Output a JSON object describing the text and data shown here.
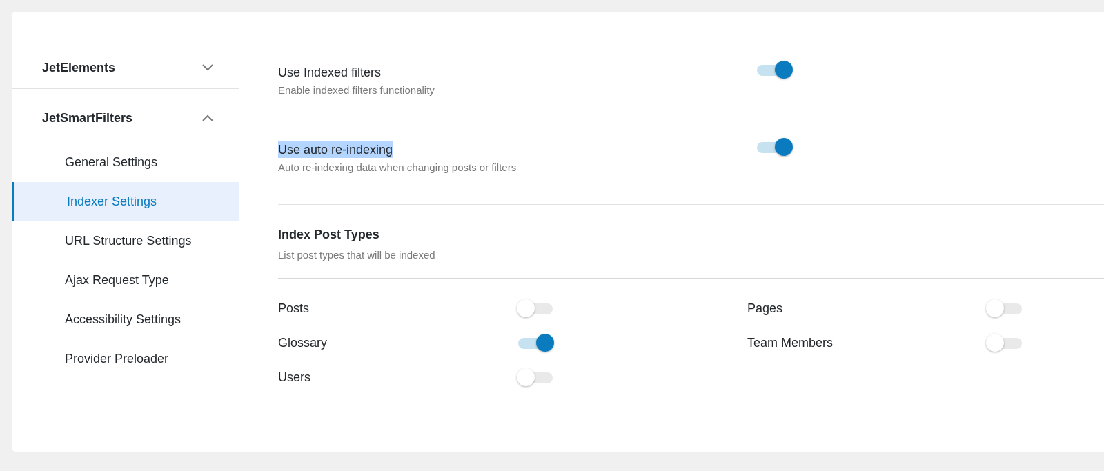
{
  "sidebar": {
    "groups": [
      {
        "label": "JetElements",
        "expanded": false
      },
      {
        "label": "JetSmartFilters",
        "expanded": true,
        "items": [
          {
            "label": "General Settings",
            "selected": false
          },
          {
            "label": "Indexer Settings",
            "selected": true
          },
          {
            "label": "URL Structure Settings",
            "selected": false
          },
          {
            "label": "Ajax Request Type",
            "selected": false
          },
          {
            "label": "Accessibility Settings",
            "selected": false
          },
          {
            "label": "Provider Preloader",
            "selected": false
          }
        ]
      }
    ]
  },
  "settings": [
    {
      "title": "Use Indexed filters",
      "description": "Enable indexed filters functionality",
      "on": true,
      "text_selected": false
    },
    {
      "title": "Use auto re-indexing",
      "description": "Auto re-indexing data when changing posts or filters",
      "on": true,
      "text_selected": true
    }
  ],
  "post_types": {
    "title": "Index Post Types",
    "description": "List post types that will be indexed",
    "items": [
      {
        "label": "Posts",
        "on": false
      },
      {
        "label": "Pages",
        "on": false
      },
      {
        "label": "Glossary",
        "on": true
      },
      {
        "label": "Team Members",
        "on": false
      },
      {
        "label": "Users",
        "on": false
      }
    ]
  }
}
